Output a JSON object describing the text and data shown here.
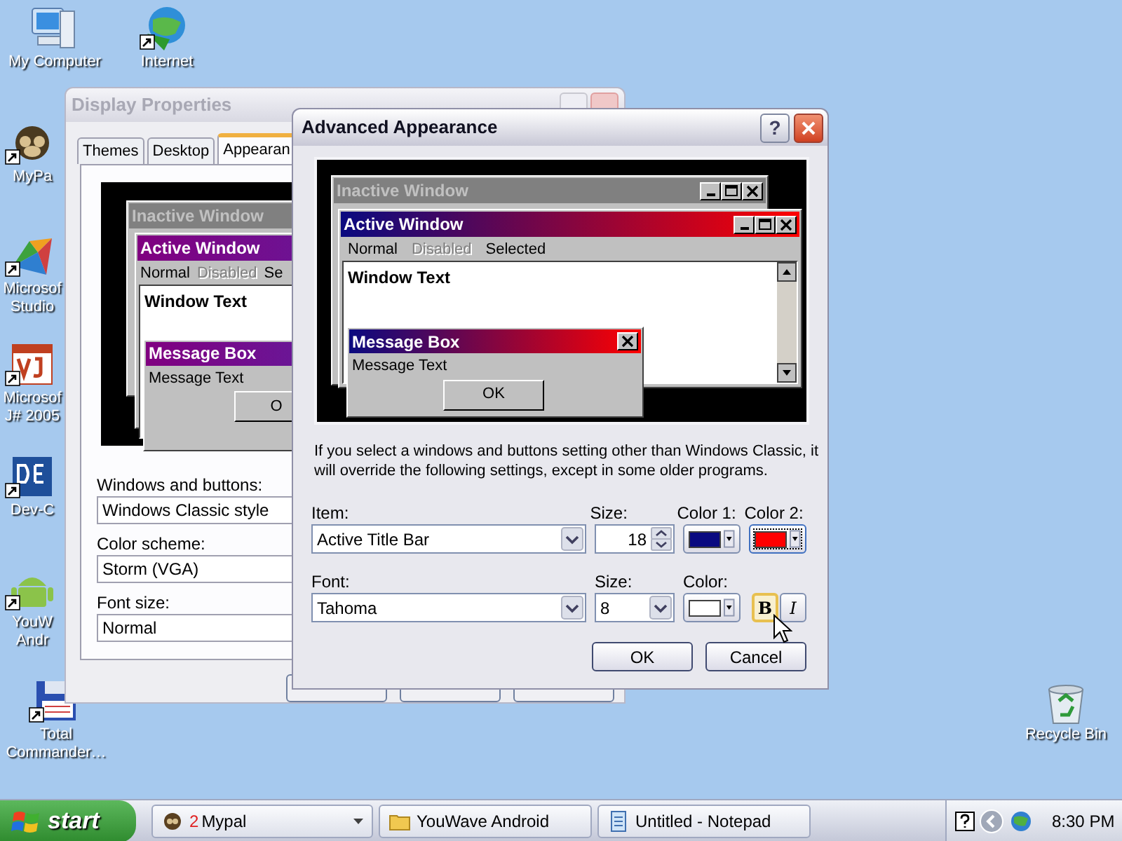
{
  "desktop_icons": [
    {
      "kind": "computer",
      "lines": [
        "My Computer"
      ]
    },
    {
      "kind": "globe",
      "lines": [
        "Internet"
      ]
    },
    {
      "kind": "monkey",
      "lines": [
        "MyPa"
      ]
    },
    {
      "kind": "studio",
      "lines": [
        "Microsof",
        "Studio"
      ]
    },
    {
      "kind": "vj",
      "lines": [
        "Microsof",
        "J# 2005"
      ]
    },
    {
      "kind": "dev",
      "lines": [
        "Dev-C"
      ]
    },
    {
      "kind": "android",
      "lines": [
        "YouW",
        "Andr"
      ]
    },
    {
      "kind": "floppy",
      "lines": [
        "Total",
        "Commander…"
      ]
    },
    {
      "kind": "recycle",
      "lines": [
        "Recycle Bin"
      ]
    }
  ],
  "display_properties": {
    "title": "Display Properties",
    "tabs": [
      {
        "label": "Themes",
        "selected": false
      },
      {
        "label": "Desktop",
        "selected": false
      },
      {
        "label": "Appearan",
        "selected": true
      }
    ],
    "preview": {
      "inactive_title": "Inactive Window",
      "active_title": "Active Window",
      "menu": [
        {
          "label": "Normal",
          "disabled": false
        },
        {
          "label": "Disabled",
          "disabled": true
        },
        {
          "label": "Se",
          "disabled": false
        }
      ],
      "window_text": "Window Text",
      "message_title": "Message Box",
      "message_text": "Message Text",
      "ok": "O"
    },
    "fields": [
      {
        "label": "Windows and buttons:",
        "value": "Windows Classic style"
      },
      {
        "label": "Color scheme:",
        "value": "Storm (VGA)"
      },
      {
        "label": "Font size:",
        "value": "Normal"
      }
    ]
  },
  "advanced": {
    "title": "Advanced Appearance",
    "help": "?",
    "preview": {
      "inactive_title": "Inactive Window",
      "active_title": "Active Window",
      "menu": [
        {
          "label": "Normal",
          "disabled": false
        },
        {
          "label": "Disabled",
          "disabled": true
        },
        {
          "label": "Selected",
          "disabled": false
        }
      ],
      "window_text": "Window Text",
      "message_title": "Message Box",
      "message_text": "Message Text",
      "ok": "OK"
    },
    "note": "If you select a windows and buttons setting other than Windows Classic, it will override the following settings, except in some older programs.",
    "item": {
      "label": "Item:",
      "value": "Active Title Bar"
    },
    "item_size": {
      "label": "Size:",
      "value": "18"
    },
    "color_1": {
      "label": "Color 1:",
      "color": "#0a0a80"
    },
    "color_2": {
      "label": "Color 2:",
      "color": "#ff0000",
      "focused": true
    },
    "font": {
      "label": "Font:",
      "value": "Tahoma"
    },
    "font_size": {
      "label": "Size:",
      "value": "8"
    },
    "font_color": {
      "label": "Color:",
      "color": "#ffffff"
    },
    "bold": {
      "label": "B",
      "highlighted": true
    },
    "italic": {
      "label": "I",
      "highlighted": false
    },
    "buttons": [
      "OK",
      "Cancel"
    ]
  },
  "taskbar": {
    "start": "start",
    "tasks": [
      {
        "kind": "monkey",
        "count": "2",
        "label": "Mypal",
        "grouped": true
      },
      {
        "kind": "folder",
        "label": "YouWave Android",
        "grouped": false
      },
      {
        "kind": "notepad",
        "label": "Untitled - Notepad",
        "grouped": false
      }
    ],
    "clock": "8:30 PM"
  }
}
